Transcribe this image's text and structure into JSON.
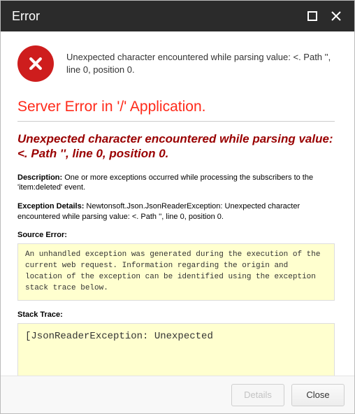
{
  "titlebar": {
    "title": "Error"
  },
  "summary": {
    "text": "Unexpected character encountered while parsing value: <. Path '', line 0, position 0."
  },
  "page": {
    "server_error_heading": "Server Error in '/' Application.",
    "exception_title": "Unexpected character encountered while parsing value: <. Path '', line 0, position 0.",
    "description_label": "Description:",
    "description_text": " One or more exceptions occurred while processing the subscribers to the 'item:deleted' event.",
    "exception_details_label": "Exception Details:",
    "exception_details_text": " Newtonsoft.Json.JsonReaderException: Unexpected character encountered while parsing value: <. Path '', line 0, position 0.",
    "source_error_label": "Source Error:",
    "source_error_block": "An unhandled exception was generated during the execution of the current web request. Information regarding the origin and location of the exception can be identified using the exception stack trace below.",
    "stack_trace_label": "Stack Trace:",
    "stack_trace_block": "[JsonReaderException: Unexpected"
  },
  "footer": {
    "details_label": "Details",
    "close_label": "Close"
  }
}
